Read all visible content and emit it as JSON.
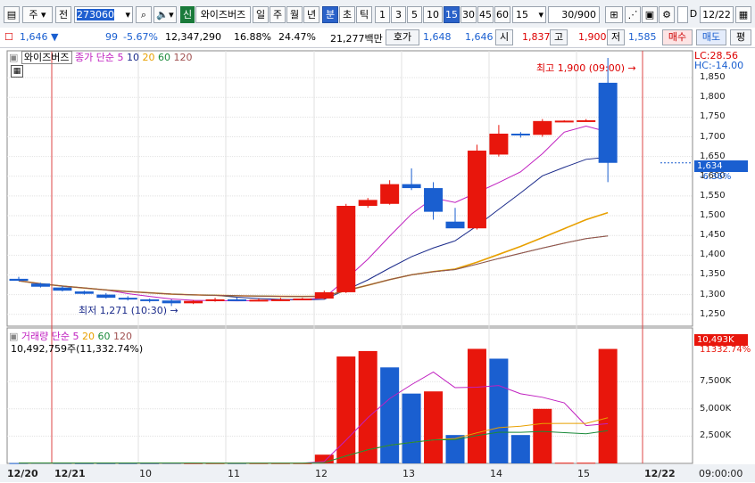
{
  "toolbar": {
    "market_label": "주",
    "prev_label": "전",
    "stock_code": "273060",
    "badge_label": "신",
    "stock_name": "와이즈버즈",
    "period_day": "일",
    "period_week": "주",
    "period_month": "월",
    "period_year": "년",
    "period_minute": "분",
    "period_second": "초",
    "period_tick": "틱",
    "intervals": [
      "1",
      "3",
      "5",
      "10",
      "15",
      "30",
      "45",
      "60"
    ],
    "selected_interval": "15",
    "interval_select_value": "15",
    "count_value": "30",
    "count_total": "/900",
    "date_value": "12/22"
  },
  "quote": {
    "price": "1,646",
    "direction": "▼",
    "change": "99",
    "change_pct": "-5.67%",
    "volume": "12,347,290",
    "rate1": "16.88%",
    "rate2": "24.47%",
    "amount": "21,277백만",
    "bid_label": "호가",
    "bid1": "1,648",
    "bid2": "1,646",
    "open_label": "시",
    "open": "1,837",
    "high_label": "고",
    "high": "1,900",
    "low_label": "저",
    "low": "1,585",
    "buy_label": "매수",
    "sell_label": "매도",
    "more_label": "평"
  },
  "price_panel": {
    "legend_name": "와이즈버즈",
    "legend_ma_label": "종가 단순",
    "ma_periods": [
      "5",
      "10",
      "20",
      "60",
      "120"
    ],
    "ma_colors": [
      "#c020c0",
      "#1a2a8a",
      "#e8a000",
      "#1a8a3a",
      "#a05050"
    ],
    "lc_label": "LC:28.56",
    "hc_label": "HC:-14.00",
    "high_annotation": "최고 1,900 (09:00) →",
    "low_annotation": "최저 1,271 (10:30) →",
    "current_price_tag": "1,634",
    "current_change_tag": "-6.36%",
    "y_ticks": [
      "1,850",
      "1,800",
      "1,750",
      "1,700",
      "1,650",
      "1,600",
      "1,550",
      "1,500",
      "1,450",
      "1,400",
      "1,350",
      "1,300",
      "1,250"
    ]
  },
  "volume_panel": {
    "legend_name": "거래량",
    "legend_ma_label": "단순",
    "ma_periods": [
      "5",
      "20",
      "60",
      "120"
    ],
    "info_text": "10,492,759주(11,332.74%)",
    "volume_tag": "10,493K",
    "volume_pct_tag": "11332.74%",
    "y_ticks": [
      "7,500K",
      "5,000K",
      "2,500K"
    ]
  },
  "x_axis": {
    "labels": [
      "12/20",
      "12/21",
      "10",
      "11",
      "12",
      "13",
      "14",
      "15",
      "12/22",
      "09:00:00"
    ]
  },
  "colors": {
    "up": "#e8160c",
    "down": "#1a5fd0",
    "accent": "#2a62c9"
  },
  "chart_data": {
    "type": "candlestick",
    "interval": "15min",
    "candles": [
      {
        "o": 1340,
        "h": 1345,
        "l": 1335,
        "c": 1335,
        "dir": "down"
      },
      {
        "o": 1328,
        "h": 1330,
        "l": 1318,
        "c": 1320,
        "dir": "down"
      },
      {
        "o": 1318,
        "h": 1322,
        "l": 1308,
        "c": 1310,
        "dir": "down"
      },
      {
        "o": 1308,
        "h": 1310,
        "l": 1300,
        "c": 1302,
        "dir": "down"
      },
      {
        "o": 1300,
        "h": 1304,
        "l": 1290,
        "c": 1292,
        "dir": "down"
      },
      {
        "o": 1292,
        "h": 1296,
        "l": 1285,
        "c": 1288,
        "dir": "down"
      },
      {
        "o": 1288,
        "h": 1290,
        "l": 1280,
        "c": 1285,
        "dir": "down"
      },
      {
        "o": 1285,
        "h": 1288,
        "l": 1271,
        "c": 1278,
        "dir": "down"
      },
      {
        "o": 1278,
        "h": 1286,
        "l": 1276,
        "c": 1284,
        "dir": "up"
      },
      {
        "o": 1284,
        "h": 1292,
        "l": 1282,
        "c": 1288,
        "dir": "up"
      },
      {
        "o": 1288,
        "h": 1292,
        "l": 1284,
        "c": 1286,
        "dir": "down"
      },
      {
        "o": 1286,
        "h": 1290,
        "l": 1283,
        "c": 1287,
        "dir": "up"
      },
      {
        "o": 1287,
        "h": 1292,
        "l": 1284,
        "c": 1288,
        "dir": "up"
      },
      {
        "o": 1288,
        "h": 1292,
        "l": 1286,
        "c": 1290,
        "dir": "up"
      },
      {
        "o": 1290,
        "h": 1310,
        "l": 1288,
        "c": 1306,
        "dir": "up"
      },
      {
        "o": 1306,
        "h": 1530,
        "l": 1304,
        "c": 1525,
        "dir": "up"
      },
      {
        "o": 1525,
        "h": 1545,
        "l": 1520,
        "c": 1540,
        "dir": "up"
      },
      {
        "o": 1530,
        "h": 1590,
        "l": 1528,
        "c": 1580,
        "dir": "up"
      },
      {
        "o": 1580,
        "h": 1620,
        "l": 1565,
        "c": 1570,
        "dir": "down"
      },
      {
        "o": 1570,
        "h": 1585,
        "l": 1490,
        "c": 1510,
        "dir": "down"
      },
      {
        "o": 1485,
        "h": 1520,
        "l": 1470,
        "c": 1468,
        "dir": "down"
      },
      {
        "o": 1468,
        "h": 1680,
        "l": 1465,
        "c": 1665,
        "dir": "up"
      },
      {
        "o": 1655,
        "h": 1730,
        "l": 1650,
        "c": 1708,
        "dir": "up"
      },
      {
        "o": 1708,
        "h": 1712,
        "l": 1698,
        "c": 1705,
        "dir": "down"
      },
      {
        "o": 1705,
        "h": 1745,
        "l": 1700,
        "c": 1740,
        "dir": "up"
      },
      {
        "o": 1740,
        "h": 1742,
        "l": 1738,
        "c": 1741,
        "dir": "up"
      },
      {
        "o": 1741,
        "h": 1745,
        "l": 1740,
        "c": 1742,
        "dir": "up"
      },
      {
        "o": 1837,
        "h": 1900,
        "l": 1585,
        "c": 1634,
        "dir": "down"
      }
    ],
    "volume": [
      {
        "v": 30,
        "dir": "down"
      },
      {
        "v": 40,
        "dir": "down"
      },
      {
        "v": 30,
        "dir": "down"
      },
      {
        "v": 20,
        "dir": "down"
      },
      {
        "v": 20,
        "dir": "down"
      },
      {
        "v": 20,
        "dir": "down"
      },
      {
        "v": 20,
        "dir": "down"
      },
      {
        "v": 30,
        "dir": "down"
      },
      {
        "v": 20,
        "dir": "up"
      },
      {
        "v": 20,
        "dir": "up"
      },
      {
        "v": 20,
        "dir": "down"
      },
      {
        "v": 20,
        "dir": "up"
      },
      {
        "v": 20,
        "dir": "up"
      },
      {
        "v": 20,
        "dir": "up"
      },
      {
        "v": 800,
        "dir": "up"
      },
      {
        "v": 9800,
        "dir": "up"
      },
      {
        "v": 10300,
        "dir": "up"
      },
      {
        "v": 8800,
        "dir": "down"
      },
      {
        "v": 6400,
        "dir": "down"
      },
      {
        "v": 6600,
        "dir": "up"
      },
      {
        "v": 2600,
        "dir": "down"
      },
      {
        "v": 10500,
        "dir": "up"
      },
      {
        "v": 9600,
        "dir": "down"
      },
      {
        "v": 2600,
        "dir": "down"
      },
      {
        "v": 5000,
        "dir": "up"
      },
      {
        "v": 60,
        "dir": "up"
      },
      {
        "v": 60,
        "dir": "up"
      },
      {
        "v": 10493,
        "dir": "up"
      }
    ],
    "ylim": [
      1220,
      1900
    ],
    "volume_ylim": [
      0,
      11600
    ]
  }
}
